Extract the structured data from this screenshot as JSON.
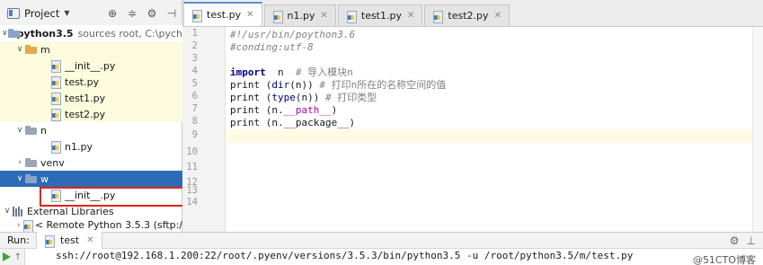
{
  "project_panel": {
    "title": "Project",
    "tree": [
      {
        "label": "python3.5",
        "suffix": "sources root, C:\\pych",
        "depth": 0,
        "expanded": true,
        "icon": "root-folder-icon",
        "style": "bold",
        "bg": ""
      },
      {
        "label": "m",
        "depth": 1,
        "expanded": true,
        "icon": "package-folder-icon",
        "bg": "yellow"
      },
      {
        "label": "__init__.py",
        "depth": 2,
        "icon": "python-file-icon",
        "bg": "yellow"
      },
      {
        "label": "test.py",
        "depth": 2,
        "icon": "python-file-icon",
        "bg": "yellow"
      },
      {
        "label": "test1.py",
        "depth": 2,
        "icon": "python-file-icon",
        "bg": "yellow"
      },
      {
        "label": "test2.py",
        "depth": 2,
        "icon": "python-file-icon",
        "bg": "yellow"
      },
      {
        "label": "n",
        "depth": 1,
        "expanded": true,
        "icon": "folder-icon",
        "bg": ""
      },
      {
        "label": "n1.py",
        "depth": 2,
        "icon": "python-file-icon",
        "bg": ""
      },
      {
        "label": "venv",
        "depth": 1,
        "expanded": false,
        "icon": "folder-icon",
        "bg": ""
      },
      {
        "label": "w",
        "depth": 1,
        "expanded": true,
        "icon": "folder-icon",
        "bg": "selected"
      },
      {
        "label": "__init__.py",
        "depth": 2,
        "icon": "python-file-icon",
        "bg": ""
      },
      {
        "label": "External Libraries",
        "depth": 0,
        "expanded": true,
        "icon": "libraries-icon",
        "bg": ""
      },
      {
        "label": "< Remote Python 3.5.3 (sftp:/",
        "depth": 1,
        "expanded": false,
        "icon": "python-sdk-icon",
        "bg": ""
      }
    ]
  },
  "editor": {
    "tabs": [
      {
        "label": "test.py",
        "active": true
      },
      {
        "label": "n1.py",
        "active": false
      },
      {
        "label": "test1.py",
        "active": false
      },
      {
        "label": "test2.py",
        "active": false
      }
    ],
    "line_numbers": [
      "1",
      "2",
      "3",
      "4",
      "5",
      "6",
      "7",
      "8",
      "9",
      "10",
      "11",
      "12",
      "13",
      "14"
    ],
    "code": {
      "l1": "#!/usr/bin/poython3.6",
      "l2": "#conding:utf-8",
      "l4_kw": "import",
      "l4_rest": "  n  ",
      "l4_cm": "# 导入模块n",
      "l5_fn": "print",
      "l5_a": " (",
      "l5_bi": "dir",
      "l5_b": "(n)) ",
      "l5_cm": "# 打印n所在的名称空间的值",
      "l6_fn": "print",
      "l6_a": " (",
      "l6_bi": "type",
      "l6_b": "(n)) ",
      "l6_cm": "# 打印类型",
      "l7_a": "print (n.",
      "l7_dd": "__path__",
      "l7_b": ")",
      "l8": "print (n.__package__)"
    }
  },
  "run_panel": {
    "label": "Run:",
    "tab": "test",
    "command": "ssh://root@192.168.1.200:22/root/.pyenv/versions/3.5.3/bin/python3.5 -u /root/python3.5/m/test.py",
    "watermark": "@51CTO博客"
  }
}
